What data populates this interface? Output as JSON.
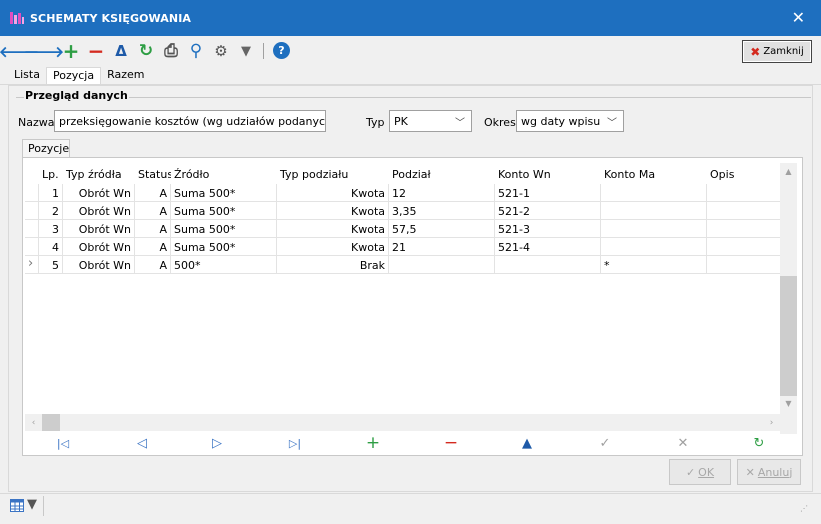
{
  "window": {
    "title": "SCHEMATY KSIĘGOWANIA",
    "close_glyph": "✕"
  },
  "toolbar": {
    "back": "🡐",
    "forward": "🡒",
    "add": "+",
    "remove": "−",
    "accept": "Δ",
    "refresh": "↻",
    "print": "⎙",
    "search": "⚲",
    "settings": "⚙",
    "filter": "▼",
    "help": "?"
  },
  "close_button": {
    "label": "Zamknij",
    "icon": "✖"
  },
  "tabs": [
    "Lista",
    "Pozycja",
    "Razem"
  ],
  "group": {
    "title": "Przegląd danych"
  },
  "form": {
    "nazwa_label": "Nazwa",
    "nazwa_value": "przeksięgowanie kosztów (wg udziałów podanych)",
    "typ_label": "Typ",
    "typ_value": "PK",
    "okres_label": "Okres",
    "okres_value": "wg daty wpisu"
  },
  "subtab": "Pozycje",
  "grid": {
    "columns": [
      "Lp.",
      "Typ źródła",
      "Status",
      "Źródło",
      "Typ podziału",
      "Podział",
      "Konto Wn",
      "Konto Ma",
      "Opis"
    ],
    "rows": [
      {
        "lp": "1",
        "typ": "Obrót Wn",
        "status": "A",
        "zrodlo": "Suma 500*",
        "typ_podzialu": "Kwota",
        "podzial": "12",
        "wn": "521-1",
        "ma": "",
        "opis": ""
      },
      {
        "lp": "2",
        "typ": "Obrót Wn",
        "status": "A",
        "zrodlo": "Suma 500*",
        "typ_podzialu": "Kwota",
        "podzial": "3,35",
        "wn": "521-2",
        "ma": "",
        "opis": ""
      },
      {
        "lp": "3",
        "typ": "Obrót Wn",
        "status": "A",
        "zrodlo": "Suma 500*",
        "typ_podzialu": "Kwota",
        "podzial": "57,5",
        "wn": "521-3",
        "ma": "",
        "opis": ""
      },
      {
        "lp": "4",
        "typ": "Obrót Wn",
        "status": "A",
        "zrodlo": "Suma 500*",
        "typ_podzialu": "Kwota",
        "podzial": "21",
        "wn": "521-4",
        "ma": "",
        "opis": ""
      },
      {
        "lp": "5",
        "typ": "Obrót Wn",
        "status": "A",
        "zrodlo": "500*",
        "typ_podzialu": "Brak",
        "podzial": "",
        "wn": "",
        "ma": "*",
        "opis": ""
      }
    ],
    "current_row_marker": "›"
  },
  "nav": {
    "first": "|◁",
    "prev": "◁",
    "next": "▷",
    "last": "▷|",
    "add": "+",
    "remove": "−",
    "up": "▲",
    "accept": "✓",
    "cancel": "✕",
    "refresh": "↻"
  },
  "buttons": {
    "ok": "OK",
    "ok_icon": "✓",
    "cancel": "Anuluj",
    "cancel_icon": "✕"
  },
  "colors": {
    "titlebar": "#1e6fbf",
    "accent_blue": "#1e6fbf",
    "add_green": "#2e9e44",
    "remove_red": "#d42a1f",
    "nav_blue": "#3b74c4"
  }
}
